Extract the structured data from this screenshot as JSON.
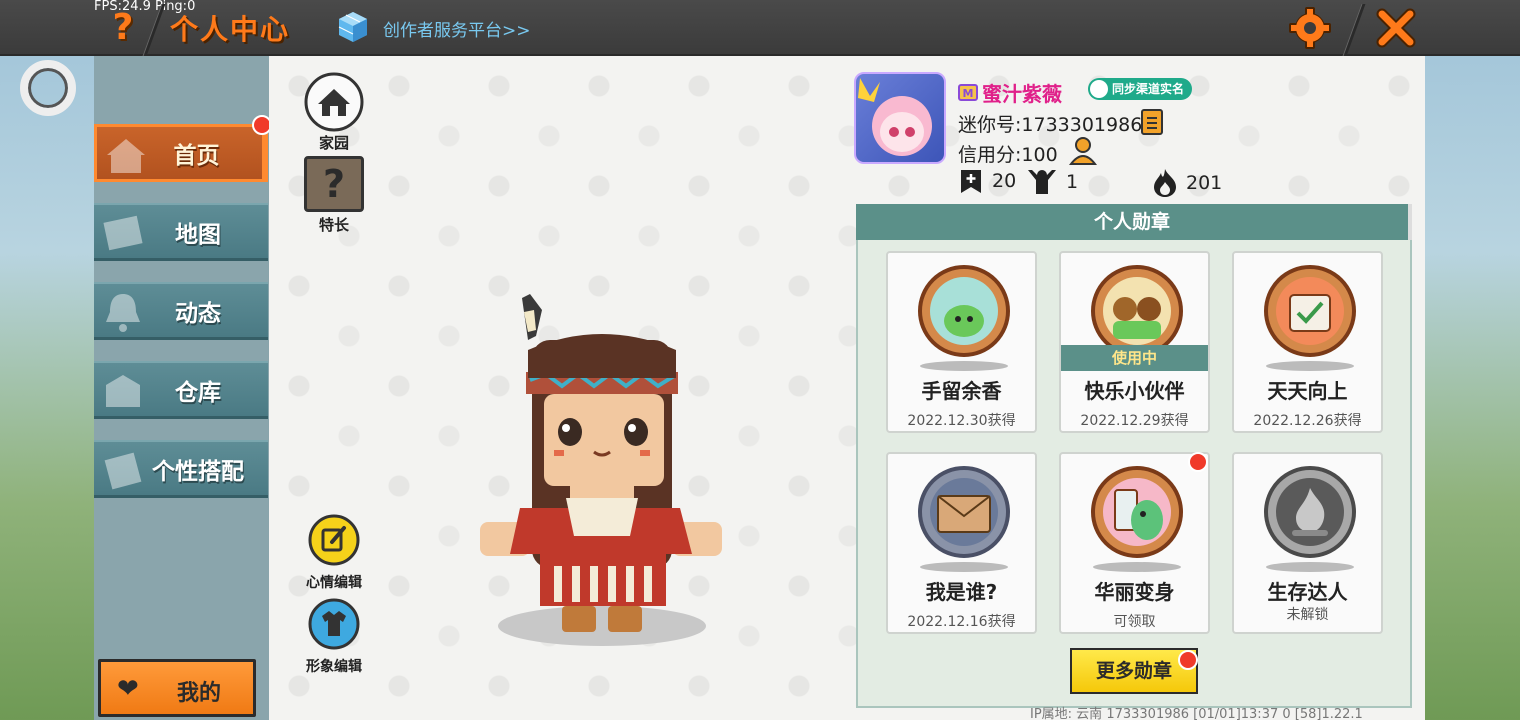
{
  "topbar": {
    "fps": "FPS:24.9  Ping:0",
    "help_symbol": "?",
    "title": "个人中心",
    "creator_link": "创作者服务平台>>",
    "close_symbol": "✕"
  },
  "sidebar": {
    "items": [
      {
        "label": "首页",
        "icon": "house-icon",
        "active": true
      },
      {
        "label": "地图",
        "icon": "map-icon",
        "active": false
      },
      {
        "label": "动态",
        "icon": "bell-icon",
        "active": false
      },
      {
        "label": "仓库",
        "icon": "warehouse-icon",
        "active": false
      },
      {
        "label": "个性搭配",
        "icon": "outfit-icon",
        "active": false
      }
    ],
    "mine_label": "我的"
  },
  "side_buttons": {
    "home": "家园",
    "talent": "特长",
    "talent_symbol": "?",
    "mood_edit": "心情编辑",
    "look_edit": "形象编辑"
  },
  "profile": {
    "name": "蜜汁紫薇",
    "sync_label": "同步渠道实名",
    "mini_id": "迷你号:1733301986",
    "credit": "信用分:100",
    "stats": {
      "posts": "20",
      "fans": "1",
      "popularity": "201"
    }
  },
  "badges": {
    "header": "个人勋章",
    "in_use_label": "使用中",
    "items": [
      {
        "name": "手留余香",
        "date": "2022.12.30获得",
        "color": "#7ccf6a"
      },
      {
        "name": "快乐小伙伴",
        "date": "2022.12.29获得",
        "color": "#c98a3a",
        "in_use": true
      },
      {
        "name": "天天向上",
        "date": "2022.12.26获得",
        "color": "#e86a5a"
      },
      {
        "name": "我是谁?",
        "date": "2022.12.16获得",
        "color": "#c89a6a"
      },
      {
        "name": "华丽变身",
        "date": "可领取",
        "color": "#5cc27a"
      },
      {
        "name": "生存达人",
        "date": "未解锁",
        "color": "#8a8a8a"
      }
    ],
    "more_label": "更多勋章"
  },
  "footer": {
    "text": "IP属地: 云南     1733301986    [01/01]13:37 0  [58]1.22.1"
  },
  "colors": {
    "accent": "#ff7a1a",
    "menu": "#4a7a84",
    "badge_header": "#5b9089"
  }
}
